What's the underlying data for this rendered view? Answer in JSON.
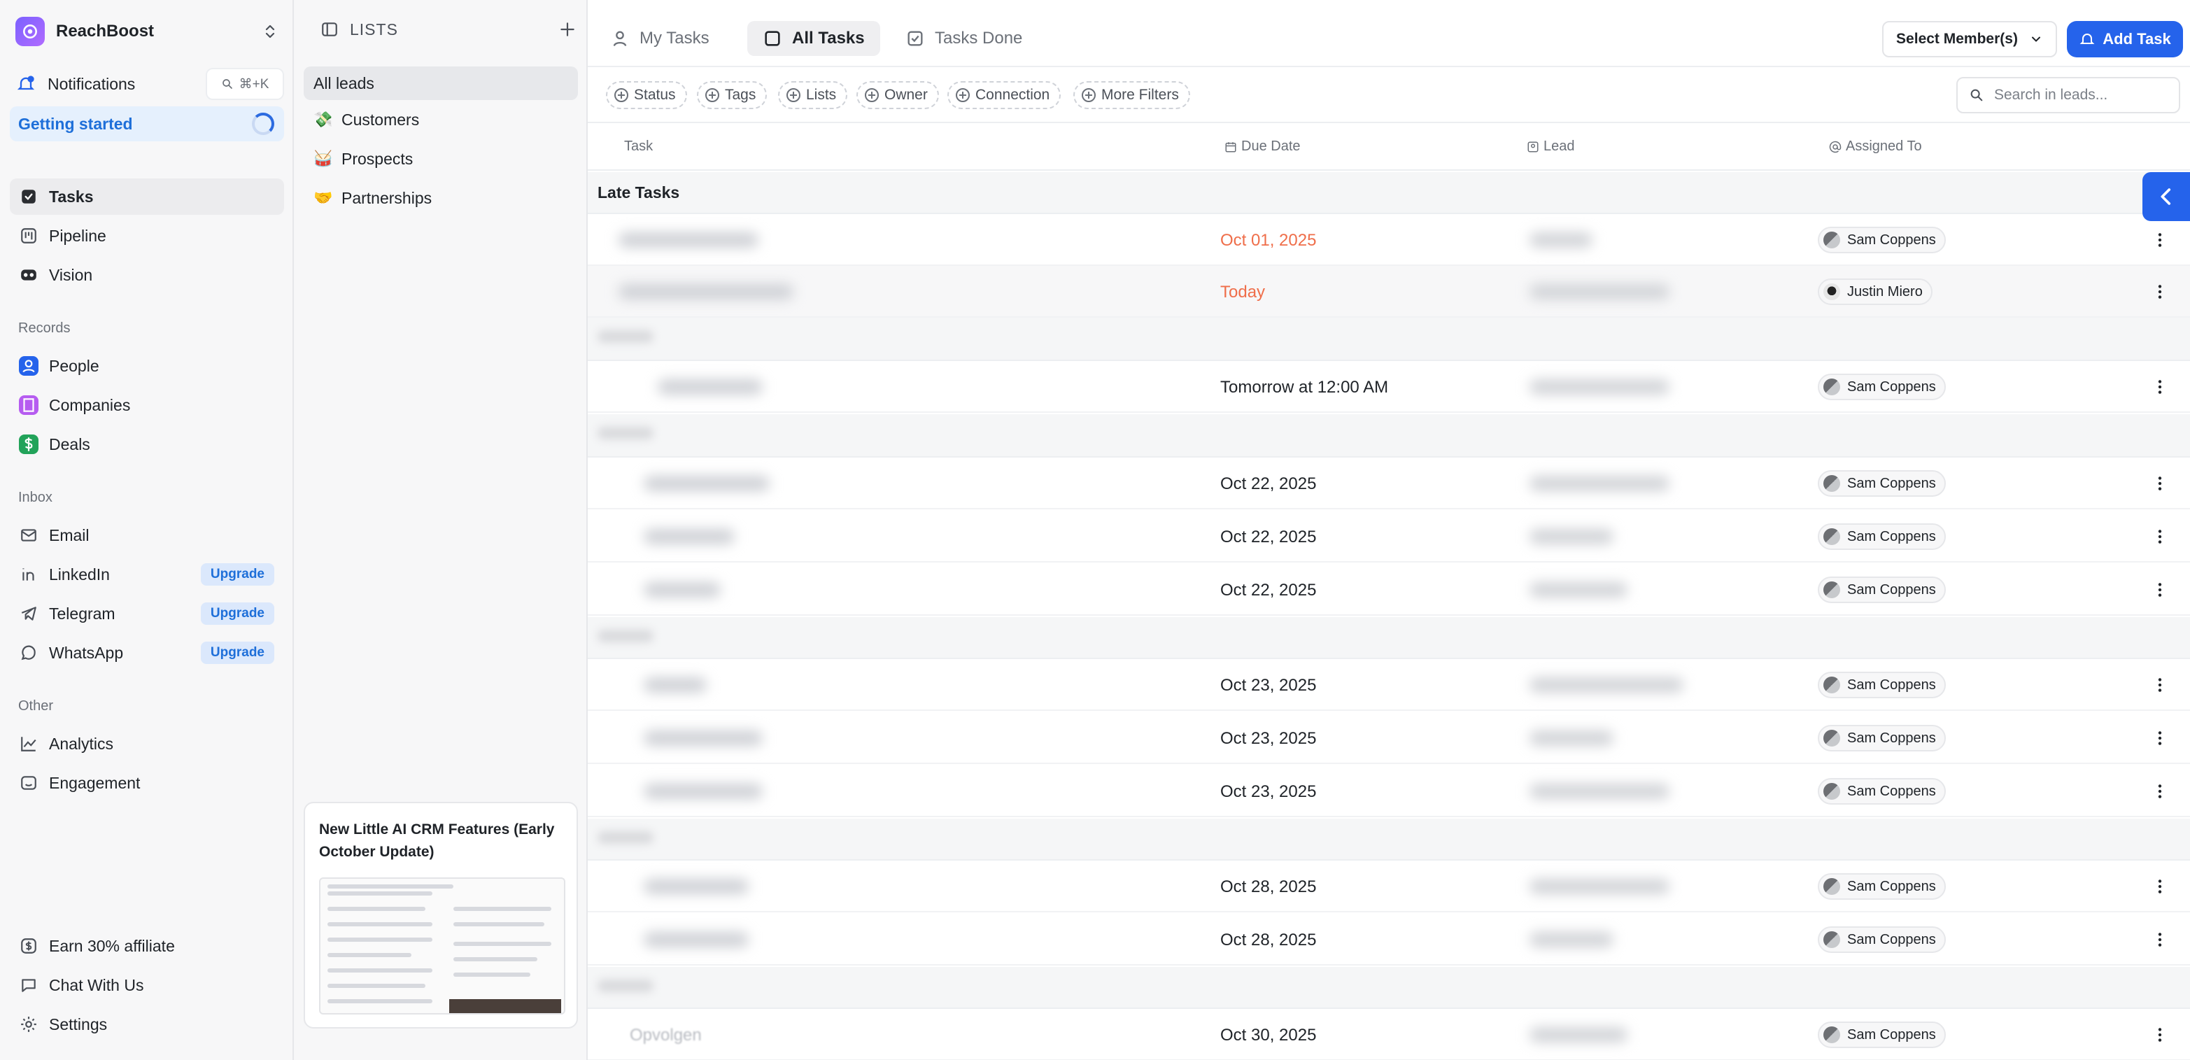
{
  "workspace": {
    "name": "ReachBoost"
  },
  "notifications": {
    "label": "Notifications",
    "shortcut": "⌘+K"
  },
  "getting_started": {
    "label": "Getting started"
  },
  "nav_main": [
    {
      "label": "Tasks",
      "icon": "tasks-icon",
      "active": true
    },
    {
      "label": "Pipeline",
      "icon": "pipeline-icon"
    },
    {
      "label": "Vision",
      "icon": "vision-icon"
    }
  ],
  "sections": {
    "records": "Records",
    "inbox": "Inbox",
    "other": "Other"
  },
  "records": [
    {
      "label": "People",
      "icon": "people-icon",
      "color": "#2563eb"
    },
    {
      "label": "Companies",
      "icon": "companies-icon",
      "color": "#b65cf0"
    },
    {
      "label": "Deals",
      "icon": "deals-icon",
      "color": "#22a35a"
    }
  ],
  "inbox": [
    {
      "label": "Email",
      "icon": "email-icon",
      "badge": ""
    },
    {
      "label": "LinkedIn",
      "icon": "linkedin-icon",
      "badge": "Upgrade"
    },
    {
      "label": "Telegram",
      "icon": "telegram-icon",
      "badge": "Upgrade"
    },
    {
      "label": "WhatsApp",
      "icon": "whatsapp-icon",
      "badge": "Upgrade"
    }
  ],
  "other": [
    {
      "label": "Analytics",
      "icon": "analytics-icon"
    },
    {
      "label": "Engagement",
      "icon": "engagement-icon"
    }
  ],
  "footer_nav": [
    {
      "label": "Earn 30% affiliate",
      "icon": "dollar-icon"
    },
    {
      "label": "Chat With Us",
      "icon": "chat-icon"
    },
    {
      "label": "Settings",
      "icon": "gear-icon"
    }
  ],
  "lists_panel": {
    "title": "LISTS",
    "items": [
      {
        "label": "All leads",
        "emoji": "",
        "active": true
      },
      {
        "label": "Customers",
        "emoji": "💸"
      },
      {
        "label": "Prospects",
        "emoji": "🥁"
      },
      {
        "label": "Partnerships",
        "emoji": "🤝"
      }
    ],
    "promo_title": "New Little AI CRM Features (Early October Update)"
  },
  "tabs": [
    {
      "label": "My Tasks",
      "icon": "user-icon"
    },
    {
      "label": "All Tasks",
      "icon": "checkbox-icon",
      "active": true
    },
    {
      "label": "Tasks Done",
      "icon": "check-square-icon"
    }
  ],
  "member_select": {
    "label": "Select Member(s)"
  },
  "add_task": {
    "label": "Add Task"
  },
  "filters": [
    "Status",
    "Tags",
    "Lists",
    "Owner",
    "Connection",
    "More Filters"
  ],
  "search": {
    "placeholder": "Search in leads..."
  },
  "columns": {
    "task": "Task",
    "due": "Due Date",
    "lead": "Lead",
    "assigned": "Assigned To"
  },
  "groups": {
    "late": "Late Tasks"
  },
  "rows": [
    {
      "due": "Oct 01, 2025",
      "late": true,
      "assignee": "Sam Coppens"
    },
    {
      "due": "Today",
      "late": true,
      "assignee": "Justin Miero"
    },
    {
      "due": "Tomorrow at 12:00 AM",
      "assignee": "Sam Coppens"
    },
    {
      "due": "Oct 22, 2025",
      "assignee": "Sam Coppens"
    },
    {
      "due": "Oct 22, 2025",
      "assignee": "Sam Coppens"
    },
    {
      "due": "Oct 22, 2025",
      "assignee": "Sam Coppens"
    },
    {
      "due": "Oct 23, 2025",
      "assignee": "Sam Coppens"
    },
    {
      "due": "Oct 23, 2025",
      "assignee": "Sam Coppens"
    },
    {
      "due": "Oct 23, 2025",
      "assignee": "Sam Coppens"
    },
    {
      "due": "Oct 28, 2025",
      "assignee": "Sam Coppens"
    },
    {
      "due": "Oct 28, 2025",
      "assignee": "Sam Coppens"
    },
    {
      "due": "Oct 30, 2025",
      "assignee": "Sam Coppens",
      "task": "Opvolgen"
    }
  ]
}
